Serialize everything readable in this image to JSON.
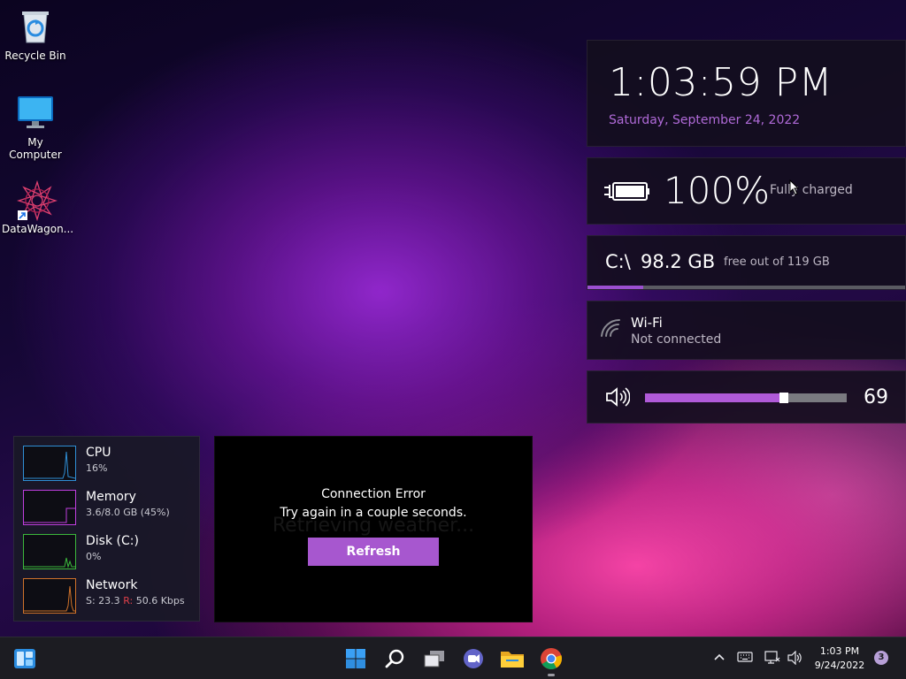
{
  "desktop": {
    "icons": [
      {
        "label": "Recycle Bin"
      },
      {
        "label": "My Computer"
      },
      {
        "label": "DataWagon..."
      }
    ]
  },
  "clock_widget": {
    "time": "1:03:59 PM",
    "date": "Saturday, September 24, 2022",
    "date_color": "#b06ad8"
  },
  "battery_widget": {
    "percent": "100%",
    "status": "Fully charged",
    "level": 1.0,
    "icon": "battery-charging-icon"
  },
  "disk_widget": {
    "drive": "C:\\",
    "free": "98.2 GB",
    "detail": "free out of 119 GB",
    "used_fraction": 0.175,
    "accent": "#9b4fd0"
  },
  "wifi_widget": {
    "name": "Wi-Fi",
    "status": "Not connected",
    "icon": "wifi-icon"
  },
  "volume_widget": {
    "value": "69",
    "level": 0.69,
    "accent": "#b05ad8",
    "icon": "speaker-icon"
  },
  "monitor": {
    "rows": [
      {
        "name": "CPU",
        "value": "16%",
        "color": "#2f8fd6"
      },
      {
        "name": "Memory",
        "value": "3.6/8.0 GB (45%)",
        "color": "#c03fe0"
      },
      {
        "name": "Disk (C:)",
        "value": "0%",
        "color": "#3cb83c"
      },
      {
        "name": "Network",
        "value_s": "S: 23.3",
        "value_r_label": "R:",
        "value_r": "50.6 Kbps",
        "color": "#d0722a",
        "r_color": "#e0404a"
      }
    ]
  },
  "weather_widget": {
    "error_title": "Connection Error",
    "error_message": "Try again in a couple seconds.",
    "background_text": "Retrieving weather...",
    "refresh_label": "Refresh",
    "button_color": "#a757cf"
  },
  "taskbar": {
    "apps": [
      "start-icon",
      "search-icon",
      "task-view-icon",
      "chat-icon",
      "file-explorer-icon",
      "chrome-icon"
    ],
    "tray": {
      "time": "1:03 PM",
      "date": "9/24/2022",
      "notification_count": "3"
    }
  }
}
